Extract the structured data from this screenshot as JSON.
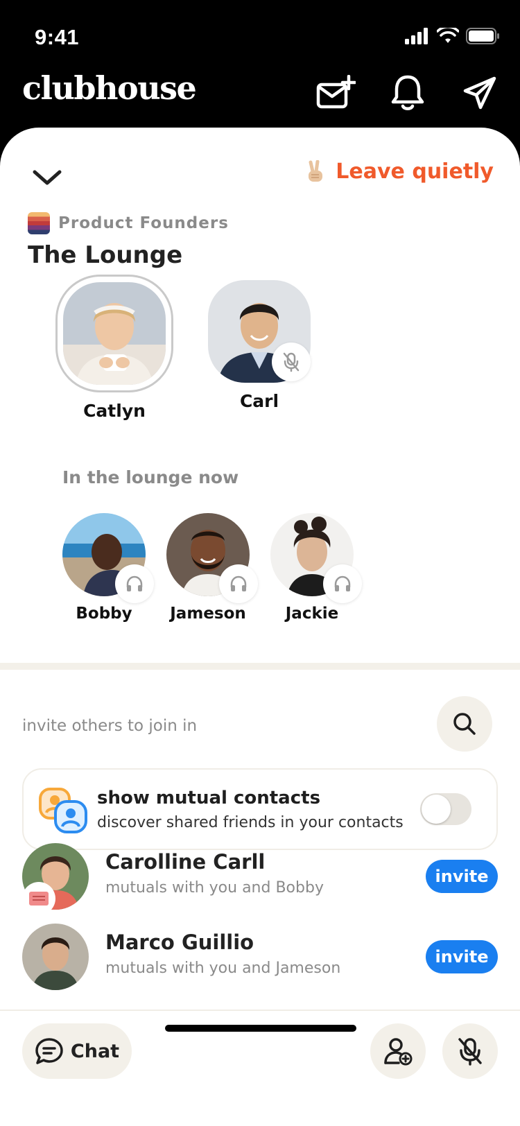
{
  "status_bar": {
    "time": "9:41"
  },
  "header": {
    "logo": "clubhouse",
    "icons": [
      "invite-envelope-icon",
      "bell-icon",
      "paper-plane-icon"
    ]
  },
  "room": {
    "leave_label": "Leave quietly",
    "club_name": "Product Founders",
    "title": "The Lounge",
    "speakers": [
      {
        "name": "Catlyn",
        "speaking": true,
        "muted": false
      },
      {
        "name": "Carl",
        "speaking": false,
        "muted": true
      }
    ],
    "listeners_heading": "In the lounge now",
    "listeners": [
      {
        "name": "Bobby"
      },
      {
        "name": "Jameson"
      },
      {
        "name": "Jackie"
      }
    ]
  },
  "invite": {
    "heading": "invite others to join in",
    "mutual": {
      "title": "show mutual contacts",
      "subtitle": "discover shared friends in your contacts",
      "enabled": false
    },
    "contacts": [
      {
        "name": "Carolline Carll",
        "sub": "mutuals with you and Bobby",
        "button": "invite"
      },
      {
        "name": "Marco Guillio",
        "sub": "mutuals with you and Jameson",
        "button": "invite"
      }
    ]
  },
  "bottom": {
    "chat_label": "Chat"
  },
  "colors": {
    "accent": "#f05a2b",
    "invite_blue": "#1a7ff0",
    "bg_beige": "#f3f0e9"
  }
}
